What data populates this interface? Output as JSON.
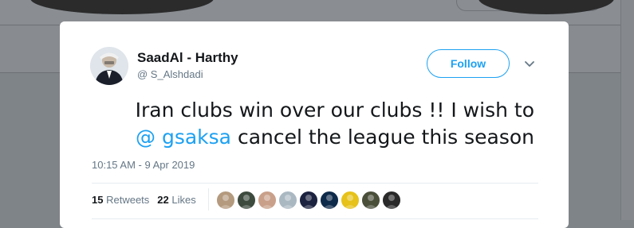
{
  "tweet": {
    "author": {
      "name": "SaadAl - Harthy",
      "handle": "@ S_Alshdadi",
      "avatar_icon": "profile-photo"
    },
    "follow_label": "Follow",
    "text": {
      "line1": "Iran clubs win over our clubs !! I wish to",
      "mention": "@ gsaksa",
      "line2_rest": " cancel the league this season"
    },
    "timestamp": "10:15 AM - 9 Apr 2019",
    "stats": {
      "retweets_count": "15",
      "retweets_label": "Retweets",
      "likes_count": "22",
      "likes_label": "Likes"
    },
    "likers": [
      {
        "name": "liker-avatar-1",
        "color": "#b49a7e"
      },
      {
        "name": "liker-avatar-2",
        "color": "#3d4a3e"
      },
      {
        "name": "liker-avatar-3",
        "color": "#c9a08a"
      },
      {
        "name": "liker-avatar-4",
        "color": "#aab8c2"
      },
      {
        "name": "liker-avatar-5",
        "color": "#1c2340"
      },
      {
        "name": "liker-avatar-6",
        "color": "#0e2a4a"
      },
      {
        "name": "liker-avatar-7",
        "color": "#e6c21a"
      },
      {
        "name": "liker-avatar-8",
        "color": "#4a4f3a"
      },
      {
        "name": "liker-avatar-9",
        "color": "#2a2a2a"
      }
    ]
  },
  "colors": {
    "accent": "#1da1f2",
    "text": "#14171a",
    "muted": "#657786"
  }
}
